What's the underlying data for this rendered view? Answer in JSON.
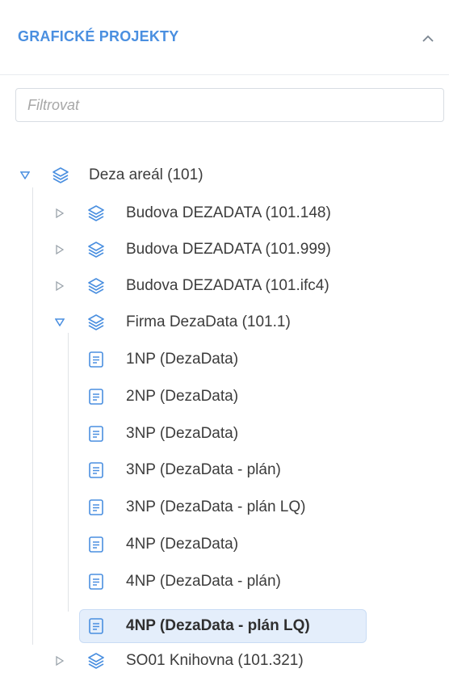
{
  "header": {
    "title": "GRAFICKÉ PROJEKTY"
  },
  "filter": {
    "placeholder": "Filtrovat",
    "value": ""
  },
  "tree": {
    "root": {
      "label": "Deza areál (101)",
      "expanded": true
    },
    "children": [
      {
        "label": "Budova DEZADATA (101.148)",
        "expanded": false
      },
      {
        "label": "Budova DEZADATA (101.999)",
        "expanded": false
      },
      {
        "label": "Budova DEZADATA (101.ifc4)",
        "expanded": false
      },
      {
        "label": "Firma DezaData (101.1)",
        "expanded": true,
        "children": [
          {
            "label": "1NP (DezaData)"
          },
          {
            "label": "2NP (DezaData)"
          },
          {
            "label": "3NP (DezaData)"
          },
          {
            "label": "3NP (DezaData - plán)"
          },
          {
            "label": "3NP (DezaData - plán LQ)"
          },
          {
            "label": "4NP (DezaData)"
          },
          {
            "label": "4NP (DezaData - plán)"
          },
          {
            "label": "4NP (DezaData - plán LQ)",
            "selected": true
          }
        ]
      },
      {
        "label": "SO01 Knihovna (101.321)",
        "expanded": false
      }
    ]
  },
  "colors": {
    "accent": "#4a8fe0",
    "selected_bg": "#e4eefb",
    "text": "#3c3c3c"
  }
}
